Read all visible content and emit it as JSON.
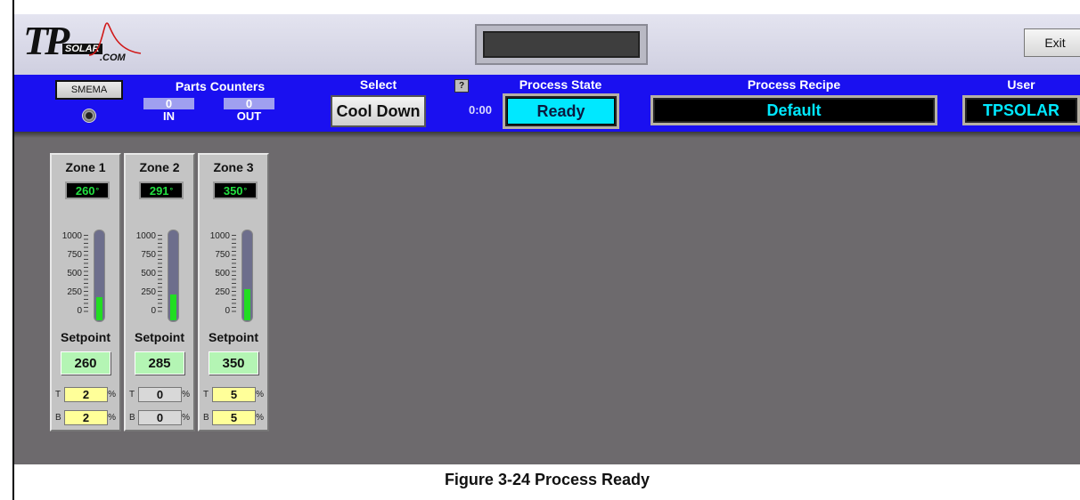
{
  "header": {
    "logo": {
      "tp": "TP",
      "solar": "SOLAR",
      "com": ".COM"
    },
    "exit_label": "Exit"
  },
  "toolbar": {
    "smema_label": "SMEMA",
    "parts_counters_title": "Parts Counters",
    "counter_in": {
      "value": "0",
      "label": "IN"
    },
    "counter_out": {
      "value": "0",
      "label": "OUT"
    },
    "select_title": "Select",
    "cool_down_label": "Cool Down",
    "help_label": "?",
    "timer": "0:00",
    "process_state_title": "Process State",
    "process_state_value": "Ready",
    "process_recipe_title": "Process Recipe",
    "process_recipe_value": "Default",
    "user_title": "User",
    "user_value": "TPSOLAR"
  },
  "zones": [
    {
      "title": "Zone 1",
      "temp": "260",
      "setpoint_label": "Setpoint",
      "setpoint": "260",
      "top_pct": "2",
      "bottom_pct": "2",
      "level_fraction": 0.26,
      "field_style": "yellow"
    },
    {
      "title": "Zone 2",
      "temp": "291",
      "setpoint_label": "Setpoint",
      "setpoint": "285",
      "top_pct": "0",
      "bottom_pct": "0",
      "level_fraction": 0.29,
      "field_style": "grey"
    },
    {
      "title": "Zone 3",
      "temp": "350",
      "setpoint_label": "Setpoint",
      "setpoint": "350",
      "top_pct": "5",
      "bottom_pct": "5",
      "level_fraction": 0.35,
      "field_style": "yellow"
    }
  ],
  "scale_ticks": [
    "1000",
    "750",
    "500",
    "250",
    "0"
  ],
  "tb_tags": {
    "top": "T",
    "bottom": "B",
    "unit": "%"
  },
  "caption": "Figure 3-24   Process Ready",
  "colors": {
    "toolbar_blue": "#1a10f0",
    "state_cyan": "#00e8ff",
    "temp_green": "#22e040",
    "setpoint_green": "#b4f5b4",
    "percent_yellow": "#ffff99"
  }
}
